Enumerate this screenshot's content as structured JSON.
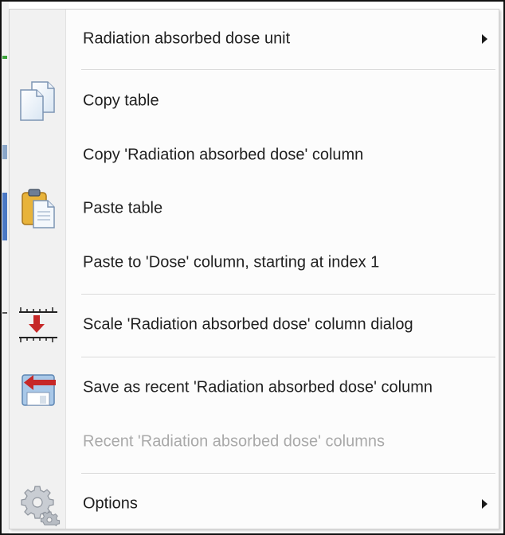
{
  "menu": {
    "items": [
      {
        "label": "Radiation absorbed dose unit",
        "submenu": true,
        "icon": "none"
      },
      {
        "label": "Copy table",
        "icon": "copy-icon"
      },
      {
        "label": "Copy 'Radiation absorbed dose' column",
        "icon": "none"
      },
      {
        "label": "Paste table",
        "icon": "paste-icon"
      },
      {
        "label": "Paste to 'Dose' column, starting at index 1",
        "icon": "none"
      },
      {
        "label": "Scale 'Radiation absorbed dose' column dialog",
        "icon": "scale-icon"
      },
      {
        "label": "Save as recent 'Radiation absorbed dose' column",
        "icon": "save-recent-icon"
      },
      {
        "label": "Recent 'Radiation absorbed dose' columns",
        "disabled": true,
        "icon": "none"
      },
      {
        "label": "Options",
        "submenu": true,
        "icon": "gear-icon"
      }
    ]
  },
  "colors": {
    "text": "#1f1f1f",
    "disabled_text": "#a9a9a9",
    "gutter": "#f1f1f1",
    "menu_bg": "#fcfcfc",
    "arrow_red": "#c62828"
  }
}
